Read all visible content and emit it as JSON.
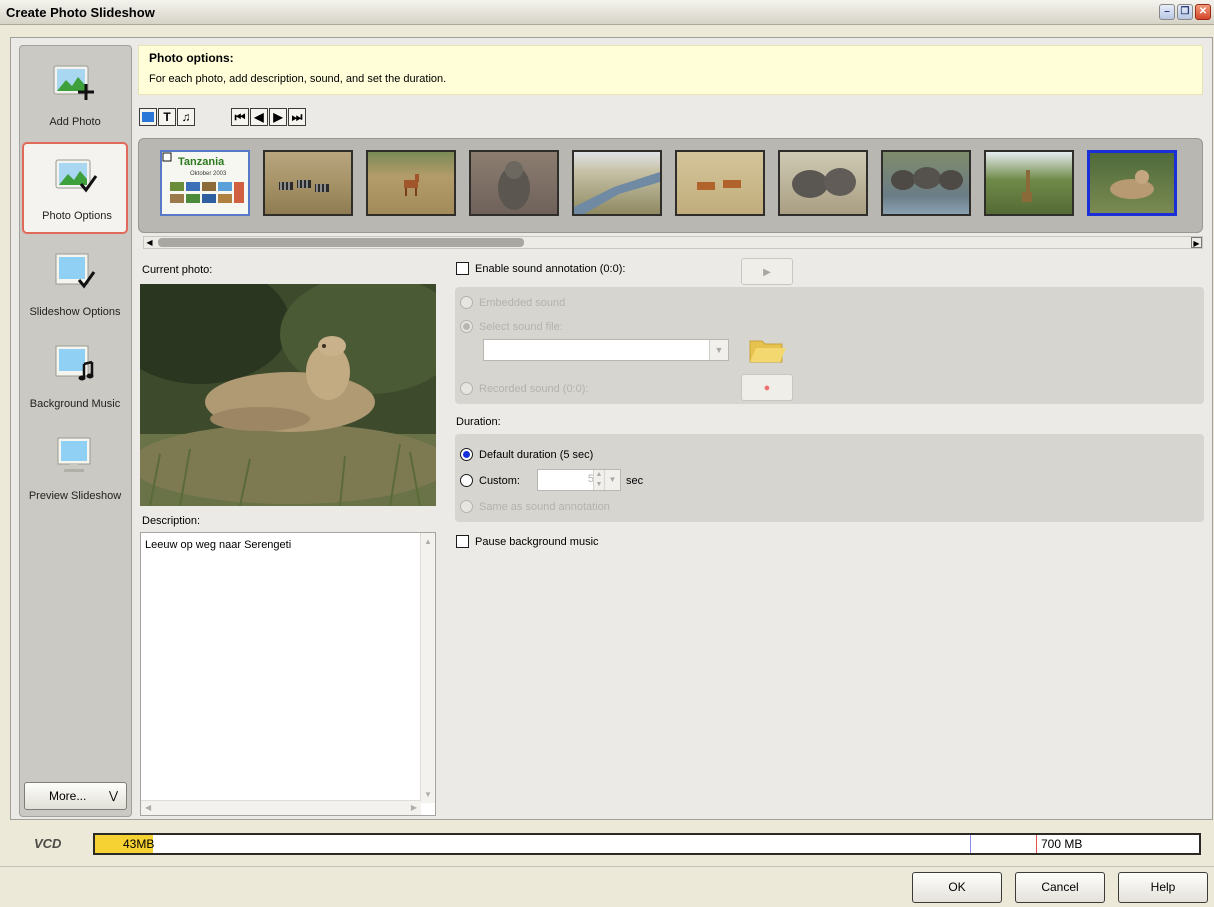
{
  "window": {
    "title": "Create Photo Slideshow"
  },
  "sidebar": {
    "items": [
      {
        "label": "Add Photo",
        "icon": "add-photo-icon"
      },
      {
        "label": "Photo Options",
        "icon": "photo-options-icon",
        "active": true
      },
      {
        "label": "Slideshow Options",
        "icon": "slideshow-options-icon"
      },
      {
        "label": "Background Music",
        "icon": "background-music-icon"
      },
      {
        "label": "Preview Slideshow",
        "icon": "preview-slideshow-icon"
      }
    ],
    "more_label": "More..."
  },
  "info": {
    "heading": "Photo options:",
    "subtext": "For each photo, add description, sound, and set the duration."
  },
  "toolbar": {
    "text_glyph": "T",
    "music_glyph": "♫"
  },
  "thumbnails": [
    {
      "kind": "title-card",
      "title": "Tanzania",
      "subtitle": "Oktober 2003"
    },
    {
      "kind": "zebras"
    },
    {
      "kind": "antelope"
    },
    {
      "kind": "baboon"
    },
    {
      "kind": "river"
    },
    {
      "kind": "impalas"
    },
    {
      "kind": "elephants"
    },
    {
      "kind": "elephants-water"
    },
    {
      "kind": "giraffe"
    },
    {
      "kind": "lioness",
      "selected": true
    }
  ],
  "current_photo": {
    "label": "Current photo:",
    "description_label": "Description:",
    "description": "Leeuw op weg naar Serengeti"
  },
  "sound": {
    "enable_label": "Enable sound annotation (0:0):",
    "embedded_label": "Embedded sound",
    "select_file_label": "Select sound file:",
    "file_value": "",
    "recorded_label": "Recorded sound (0:0):"
  },
  "duration": {
    "label": "Duration:",
    "default_label": "Default duration (5 sec)",
    "custom_label": "Custom:",
    "custom_value": "5",
    "unit": "sec",
    "same_as_label": "Same as sound annotation"
  },
  "pause_label": "Pause background music",
  "capacity": {
    "media": "VCD",
    "used_text": "43MB",
    "total_text": "700 MB",
    "used_mb": 43,
    "max_mb": 700
  },
  "buttons": {
    "ok": "OK",
    "cancel": "Cancel",
    "help": "Help"
  },
  "colors": {
    "selection_blue": "#1b2fd6",
    "bar_fill": "#f6d232",
    "info_bg": "#fffed9"
  }
}
